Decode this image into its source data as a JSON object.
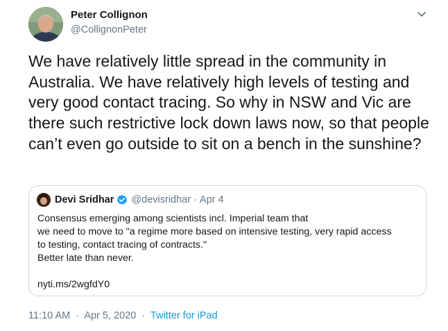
{
  "author": {
    "name": "Peter Collignon",
    "handle": "@CollignonPeter"
  },
  "tweet": {
    "text": "We have relatively little spread in the community in Australia. We have relatively high levels of testing and very good contact tracing. So why in NSW and Vic are there such restrictive lock down laws now, so that people can’t even go outside to sit on a bench in the sunshine?"
  },
  "quote": {
    "name": "Devi Sridhar",
    "handle": "@devisridhar",
    "separator": "·",
    "date": "Apr 4",
    "verified": true,
    "lines": [
      "Consensus emerging among scientists incl. Imperial team that",
      "we need to move to \"a regime more based on intensive testing, very rapid access",
      "to testing, contact tracing of contracts.\"",
      "Better late than never."
    ],
    "link": "nyti.ms/2wgfdY0"
  },
  "meta": {
    "time": "11:10 AM",
    "separator": "·",
    "date": "Apr 5, 2020",
    "source": "Twitter for iPad"
  },
  "icons": {
    "caret": "chevron-down-icon",
    "verified": "verified-badge-icon"
  },
  "colors": {
    "text": "#14171a",
    "secondary": "#657786",
    "link": "#1b95e0",
    "verified": "#1da1f2",
    "border": "#ccd6dd"
  }
}
